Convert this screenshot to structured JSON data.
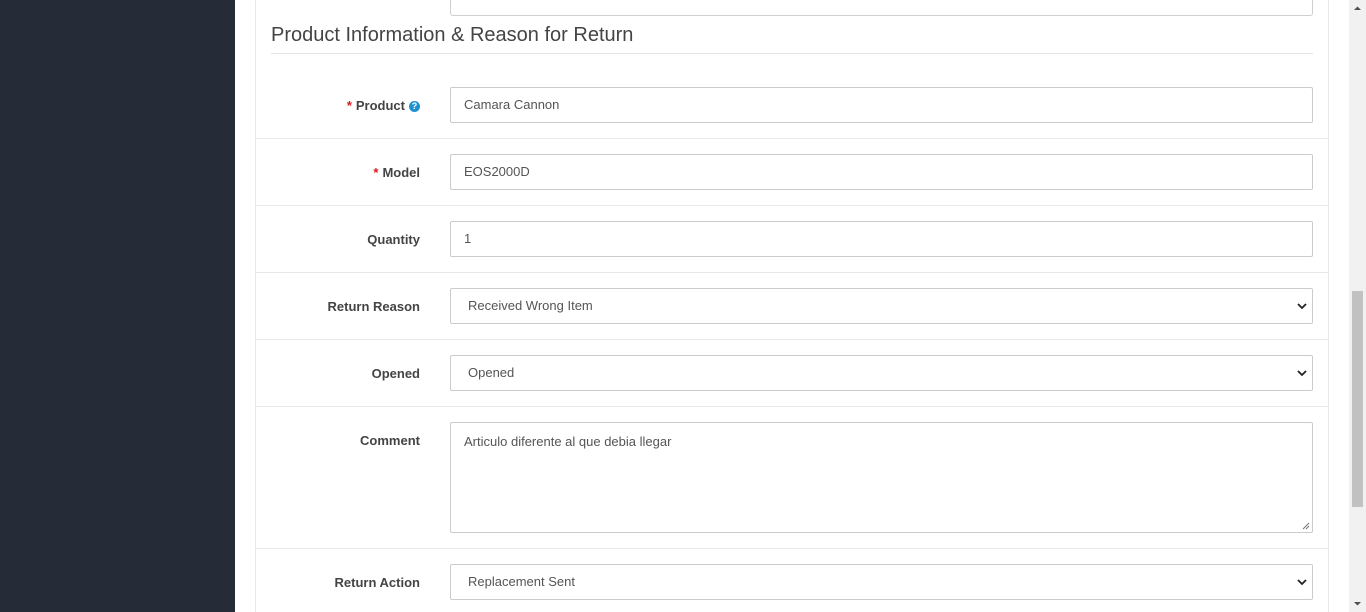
{
  "section": {
    "title": "Product Information & Reason for Return"
  },
  "fields": {
    "product": {
      "label": "Product",
      "required": "*",
      "help": "?",
      "value": "Camara Cannon"
    },
    "model": {
      "label": "Model",
      "required": "*",
      "value": "EOS2000D"
    },
    "quantity": {
      "label": "Quantity",
      "value": "1"
    },
    "return_reason": {
      "label": "Return Reason",
      "value": "Received Wrong Item"
    },
    "opened": {
      "label": "Opened",
      "value": "Opened"
    },
    "comment": {
      "label": "Comment",
      "value": "Articulo diferente al que debia llegar"
    },
    "return_action": {
      "label": "Return Action",
      "value": "Replacement Sent"
    }
  },
  "colors": {
    "sidebar": "#252c37",
    "required": "#d9191d",
    "help": "#1e91cf"
  }
}
